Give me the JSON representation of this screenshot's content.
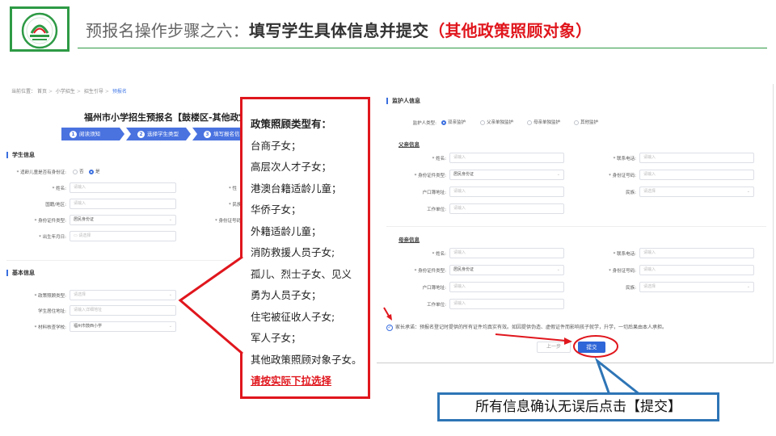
{
  "header": {
    "title_prefix": "预报名操作步骤之六：",
    "title_main": "填写学生具体信息并提交",
    "title_suffix": "（其他政策照顾对象）"
  },
  "left_form": {
    "breadcrumb": [
      "当前位置：",
      "首页",
      "小学招生",
      "招生引导",
      "预报名"
    ],
    "page_title": "福州市小学招生预报名【鼓楼区-其他政策",
    "steps": [
      {
        "num": "1",
        "label": "阅读须知"
      },
      {
        "num": "2",
        "label": "选择学生类型"
      },
      {
        "num": "3",
        "label": "填写报名信息"
      }
    ],
    "student_section": "学生信息",
    "has_id_label": "* 适龄儿童是否有身份证:",
    "has_id_options": [
      "否",
      "是"
    ],
    "name_label": "* 姓名:",
    "name_placeholder": "请输入",
    "nation_label": "国籍/地区:",
    "nation_placeholder": "请输入",
    "id_type_label": "* 身份证件类型:",
    "id_type_value": "居民身份证",
    "birth_label": "* 出生年月日:",
    "birth_placeholder": "请选择",
    "gender_label": "* 性",
    "ethnic_label": "* 民族",
    "id_no_label": "* 身份证号码",
    "basic_section": "基本信息",
    "policy_type_label": "* 政策照顾类型:",
    "policy_type_placeholder": "请选择",
    "address_label": "学生居住地址:",
    "address_placeholder": "请输入详细地址",
    "school_label": "* 材料核查学校:",
    "school_value": "福州市鼓西小学"
  },
  "callout": {
    "title": "政策照顾类型有：",
    "items": [
      "台商子女；",
      "高层次人才子女；",
      "港澳台籍适龄儿童；",
      "华侨子女；",
      "外籍适龄儿童；",
      "消防救援人员子女;",
      "孤儿、烈士子女、见义",
      "勇为人员子女；",
      "住宅被征收人子女;",
      "军人子女；",
      "其他政策照顾对象子女。"
    ],
    "note": "请按实际下拉选择"
  },
  "right_form": {
    "section": "监护人信息",
    "guardian_type_label": "监护人类型:",
    "guardian_options": [
      "双亲监护",
      "父亲单独监护",
      "母亲单独监护",
      "其他监护"
    ],
    "father_title": "父亲信息",
    "mother_title": "母亲信息",
    "name_label": "* 姓名:",
    "phone_label": "* 联系电话:",
    "id_type_label": "* 身份证件类型:",
    "id_no_label": "* 身份证号码:",
    "hukou_label": "户口簿地址:",
    "ethnic_label": "民族:",
    "work_label": "工作单位:",
    "placeholder": "请输入",
    "select_placeholder": "请选择",
    "id_type_value": "居民身份证",
    "consent_text": "家长承诺：预报名登记时提供的所有证件均真实有效。如因提供伪造、虚假证件而影响孩子就学，升学，一切后果由本人承担。",
    "prev_button": "上一步",
    "submit_button": "提交"
  },
  "bottom_note": "所有信息确认无误后点击【提交】",
  "colors": {
    "brand_green": "#2e9a45",
    "highlight_red": "#e0161d",
    "primary_blue": "#2f66d8",
    "note_border": "#2e75b6"
  }
}
